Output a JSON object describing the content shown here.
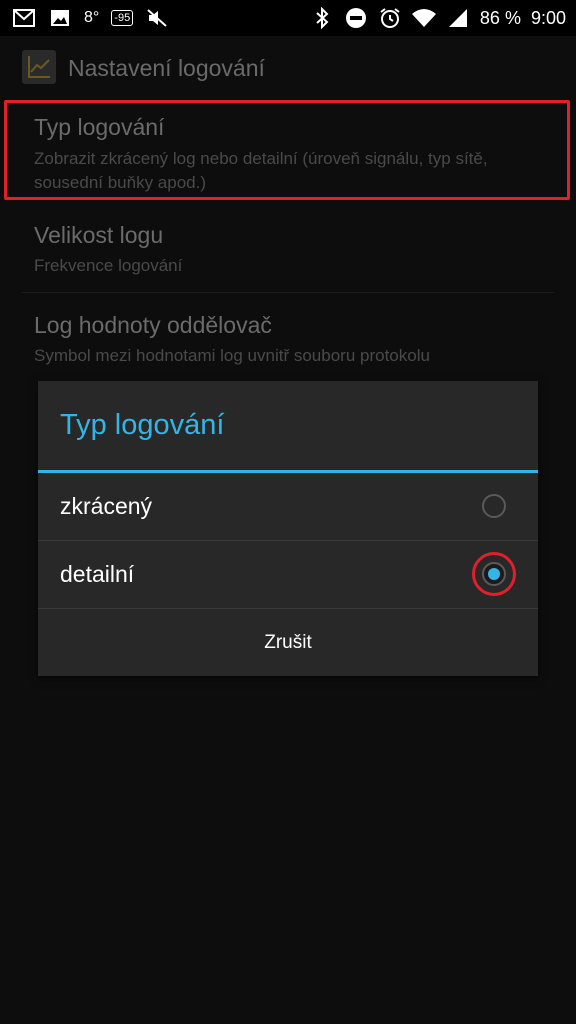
{
  "status_bar": {
    "temperature": "8°",
    "badge": "-95",
    "battery": "86 %",
    "time": "9:00",
    "icons": [
      "gmail-icon",
      "image-icon",
      "temperature",
      "badge",
      "mute-icon",
      "bluetooth-icon",
      "do-not-disturb-icon",
      "alarm-icon",
      "wifi-icon",
      "signal-icon"
    ]
  },
  "action_bar": {
    "title": "Nastavení logování"
  },
  "preferences": [
    {
      "title": "Typ logování",
      "summary": "Zobrazit zkrácený log nebo detailní (úroveň signálu, typ sítě, sousední buňky apod.)"
    },
    {
      "title": "Velikost logu",
      "summary": "Frekvence logování"
    },
    {
      "title": "Log hodnoty oddělovač",
      "summary": "Symbol mezi hodnotami log uvnitř souboru protokolu"
    }
  ],
  "dialog": {
    "title": "Typ logování",
    "options": [
      {
        "label": "zkrácený",
        "selected": false
      },
      {
        "label": "detailní",
        "selected": true
      }
    ],
    "cancel_label": "Zrušit"
  },
  "colors": {
    "accent": "#33b5e5",
    "highlight": "#e0202a",
    "dialog_bg": "#282828"
  }
}
